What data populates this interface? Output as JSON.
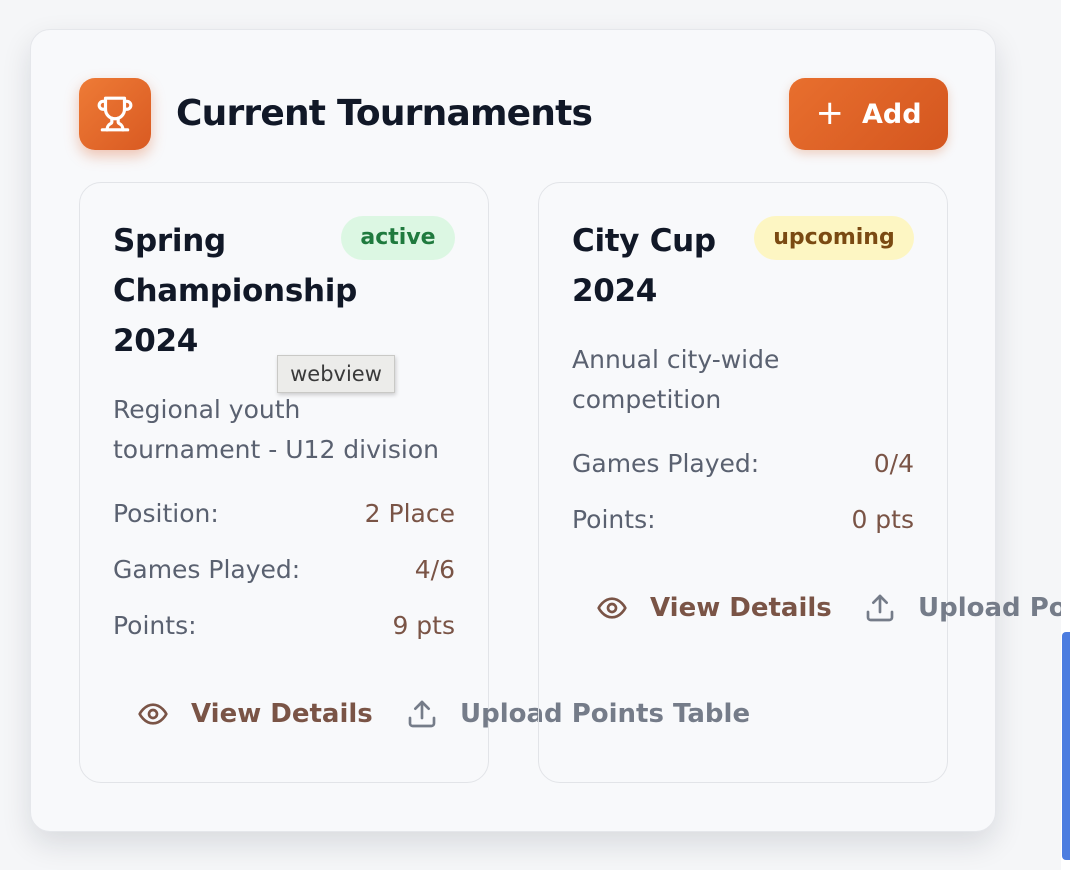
{
  "header": {
    "title": "Current Tournaments",
    "icon": "trophy-icon",
    "add_icon": "plus-icon",
    "add_label": "Add",
    "accent_color": "#e0662a"
  },
  "tooltip": {
    "text": "webview"
  },
  "tournaments": [
    {
      "title_lines": [
        "Spring",
        "Championship",
        "2024"
      ],
      "status": "active",
      "description_lines": [
        "Regional youth",
        "tournament - U12 division"
      ],
      "stats": [
        {
          "label": "Position:",
          "value": "2 Place"
        },
        {
          "label": "Games Played:",
          "value": "4/6"
        },
        {
          "label": "Points:",
          "value": "9 pts"
        }
      ],
      "view_label": "View Details",
      "upload_label": "Upload Points Table"
    },
    {
      "title_lines": [
        "City Cup",
        "2024"
      ],
      "status": "upcoming",
      "description_lines": [
        "Annual city-wide",
        "competition"
      ],
      "stats": [
        {
          "label": "Games Played:",
          "value": "0/4"
        },
        {
          "label": "Points:",
          "value": "0 pts"
        }
      ],
      "view_label": "View Details",
      "upload_label": "Upload Points Table"
    }
  ],
  "colors": {
    "status_active_bg": "#dcf7e3",
    "status_active_text": "#1f7a3e",
    "status_upcoming_bg": "#fdf6c3",
    "status_upcoming_text": "#7a4a12",
    "stat_value": "#7a5446",
    "scroll_indicator": "#4c7de0"
  }
}
